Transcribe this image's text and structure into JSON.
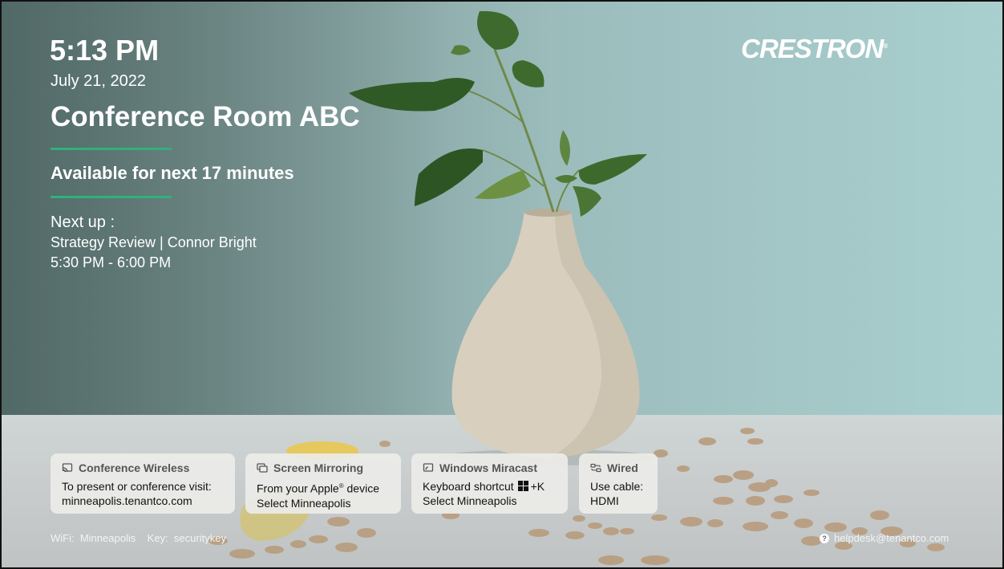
{
  "status": {
    "time": "5:13 PM",
    "date": "July 21, 2022",
    "room_name": "Conference Room ABC",
    "availability": "Available for next 17 minutes"
  },
  "next_meeting": {
    "heading": "Next up :",
    "title": "Strategy Review | Connor Bright",
    "time_range": "5:30 PM - 6:00 PM"
  },
  "brand": {
    "logo_text": "CRESTRON",
    "logo_mark": "®"
  },
  "cards": {
    "wireless": {
      "icon": "cast-icon",
      "title": "Conference Wireless",
      "line1": "To present or conference visit:",
      "line2": "minneapolis.tenantco.com"
    },
    "mirroring": {
      "icon": "screen-mirror-icon",
      "title": "Screen Mirroring",
      "line1_prefix": "From your Apple",
      "line1_mark": "®",
      "line1_suffix": " device",
      "line2": "Select Minneapolis"
    },
    "miracast": {
      "icon": "miracast-icon",
      "title": "Windows Miracast",
      "line1_prefix": "Keyboard shortcut",
      "line1_key": "+K",
      "line2": "Select Minneapolis"
    },
    "wired": {
      "icon": "cable-icon",
      "title": "Wired",
      "line1": "Use cable:",
      "line2": "HDMI"
    }
  },
  "footer": {
    "wifi_label": "WiFi:",
    "wifi_value": "Minneapolis",
    "key_label": "Key:",
    "key_value": "securitykey",
    "helpdesk_icon": "?",
    "helpdesk_email": "helpdesk@tenantco.com"
  },
  "colors": {
    "accent_rule": "#2fb17c",
    "wall": "#a9cfcf",
    "card_bg": "#ececE8"
  }
}
